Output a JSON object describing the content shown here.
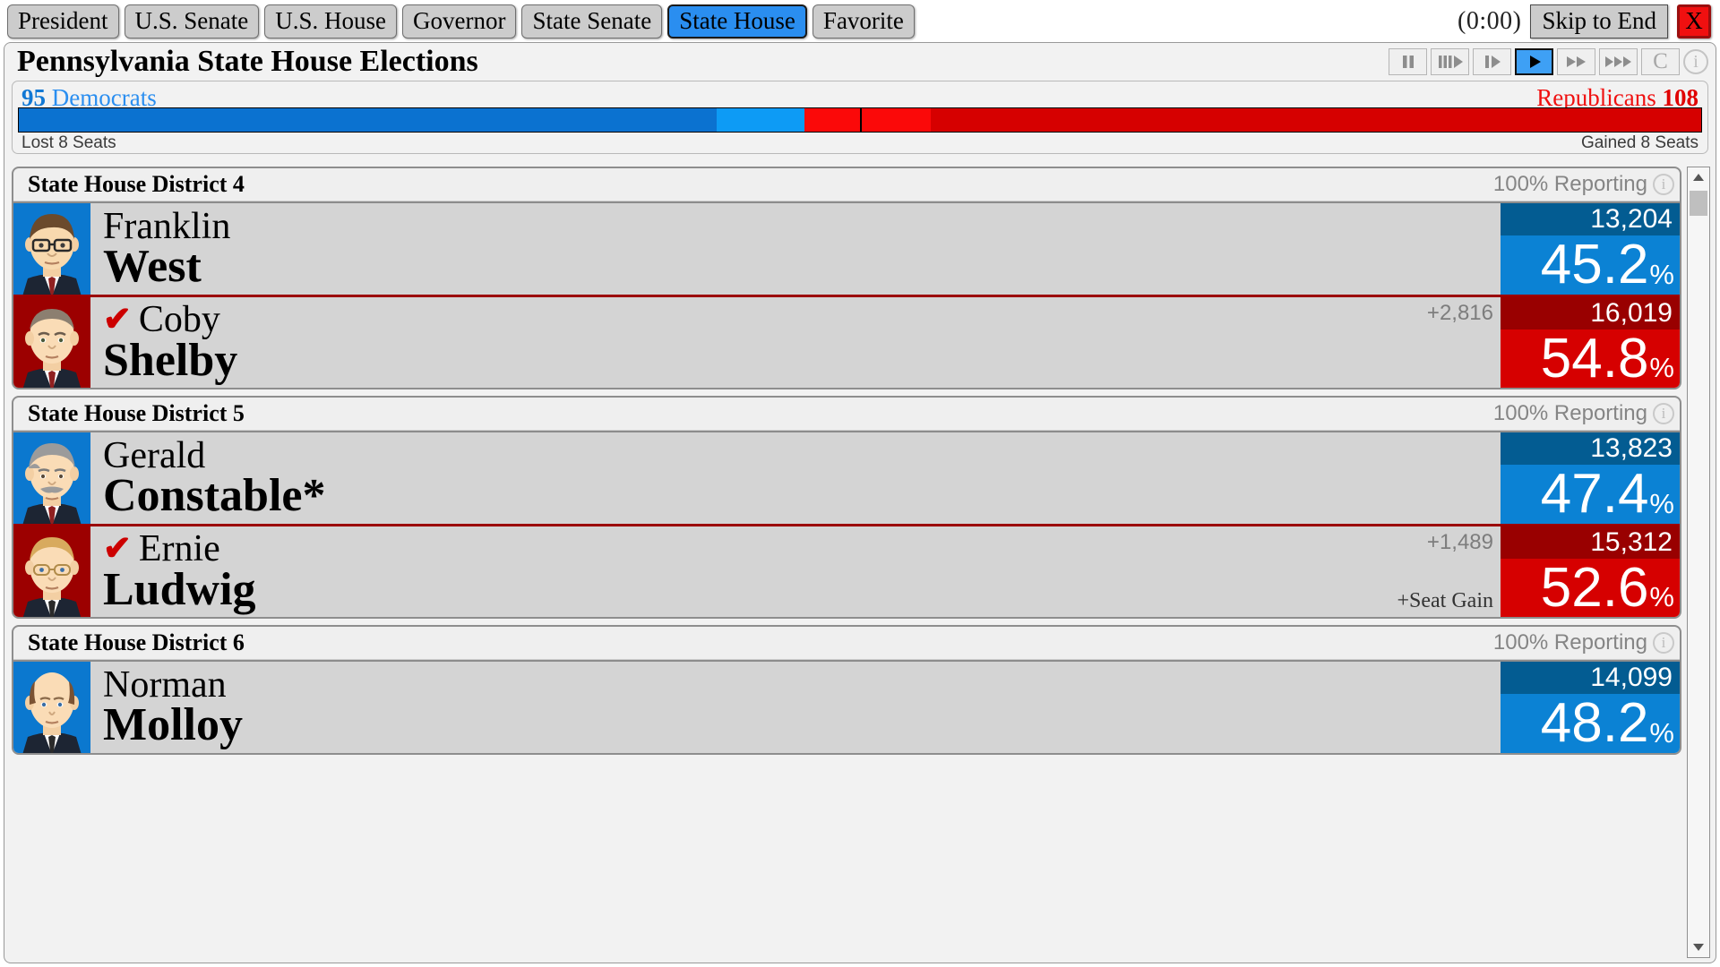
{
  "topbar": {
    "tabs": [
      {
        "label": "President",
        "active": false
      },
      {
        "label": "U.S. Senate",
        "active": false
      },
      {
        "label": "U.S. House",
        "active": false
      },
      {
        "label": "Governor",
        "active": false
      },
      {
        "label": "State Senate",
        "active": false
      },
      {
        "label": "State House",
        "active": true
      },
      {
        "label": "Favorite",
        "active": false
      }
    ],
    "timer": "(0:00)",
    "skip_label": "Skip to End",
    "close_label": "X"
  },
  "header": {
    "title": "Pennsylvania State House Elections",
    "transport": [
      {
        "name": "pause-button",
        "icon": "pause",
        "active": false
      },
      {
        "name": "rewind-step-button",
        "icon": "bars-play",
        "active": false
      },
      {
        "name": "step-button",
        "icon": "bar-play",
        "active": false
      },
      {
        "name": "play-button",
        "icon": "play",
        "active": true
      },
      {
        "name": "fast-forward-button",
        "icon": "ff2",
        "active": false
      },
      {
        "name": "very-fast-forward-button",
        "icon": "ff3",
        "active": false
      }
    ],
    "c_button_label": "C",
    "info_label": "i"
  },
  "seat_summary": {
    "dem_count": "95",
    "dem_label": "Democrats",
    "rep_label": "Republicans",
    "rep_count": "108",
    "dem_note": "Lost 8 Seats",
    "rep_note": "Gained 8 Seats",
    "bar": {
      "dem_hold_pct": 41.5,
      "dem_gain_pct": 5.2,
      "rep_gain_pct": 7.5,
      "rep_hold_pct": 45.8
    },
    "colors": {
      "dem": "#0b72d0",
      "dem_light": "#0d9bf5",
      "rep": "#d60000",
      "rep_light": "#fb0909"
    }
  },
  "districts": [
    {
      "name": "State House District 4",
      "reporting": "100% Reporting",
      "info_label": "i",
      "candidates": [
        {
          "party": "dem",
          "winner": false,
          "first_name": "Franklin",
          "last_name": "West",
          "votes": "13,204",
          "pct": "45.2",
          "pct_symbol": "%",
          "margin": "",
          "seat_note": "",
          "avatar": "brown-hair-glasses-suit"
        },
        {
          "party": "rep",
          "winner": true,
          "check": "✔",
          "first_name": "Coby",
          "last_name": "Shelby",
          "votes": "16,019",
          "pct": "54.8",
          "pct_symbol": "%",
          "margin": "+2,816",
          "seat_note": "",
          "avatar": "short-gray-hair-suit"
        }
      ]
    },
    {
      "name": "State House District 5",
      "reporting": "100% Reporting",
      "info_label": "i",
      "candidates": [
        {
          "party": "dem",
          "winner": false,
          "first_name": "Gerald",
          "last_name": "Constable*",
          "votes": "13,823",
          "pct": "47.4",
          "pct_symbol": "%",
          "margin": "",
          "seat_note": "",
          "avatar": "gray-hair-mustache"
        },
        {
          "party": "rep",
          "winner": true,
          "check": "✔",
          "first_name": "Ernie",
          "last_name": "Ludwig",
          "votes": "15,312",
          "pct": "52.6",
          "pct_symbol": "%",
          "margin": "+1,489",
          "seat_note": "+Seat Gain",
          "avatar": "blonde-glasses"
        }
      ]
    },
    {
      "name": "State House District 6",
      "reporting": "100% Reporting",
      "info_label": "i",
      "candidates": [
        {
          "party": "dem",
          "winner": false,
          "first_name": "Norman",
          "last_name": "Molloy",
          "votes": "14,099",
          "pct": "48.2",
          "pct_symbol": "%",
          "margin": "",
          "seat_note": "",
          "avatar": "balding-brown"
        }
      ]
    }
  ]
}
